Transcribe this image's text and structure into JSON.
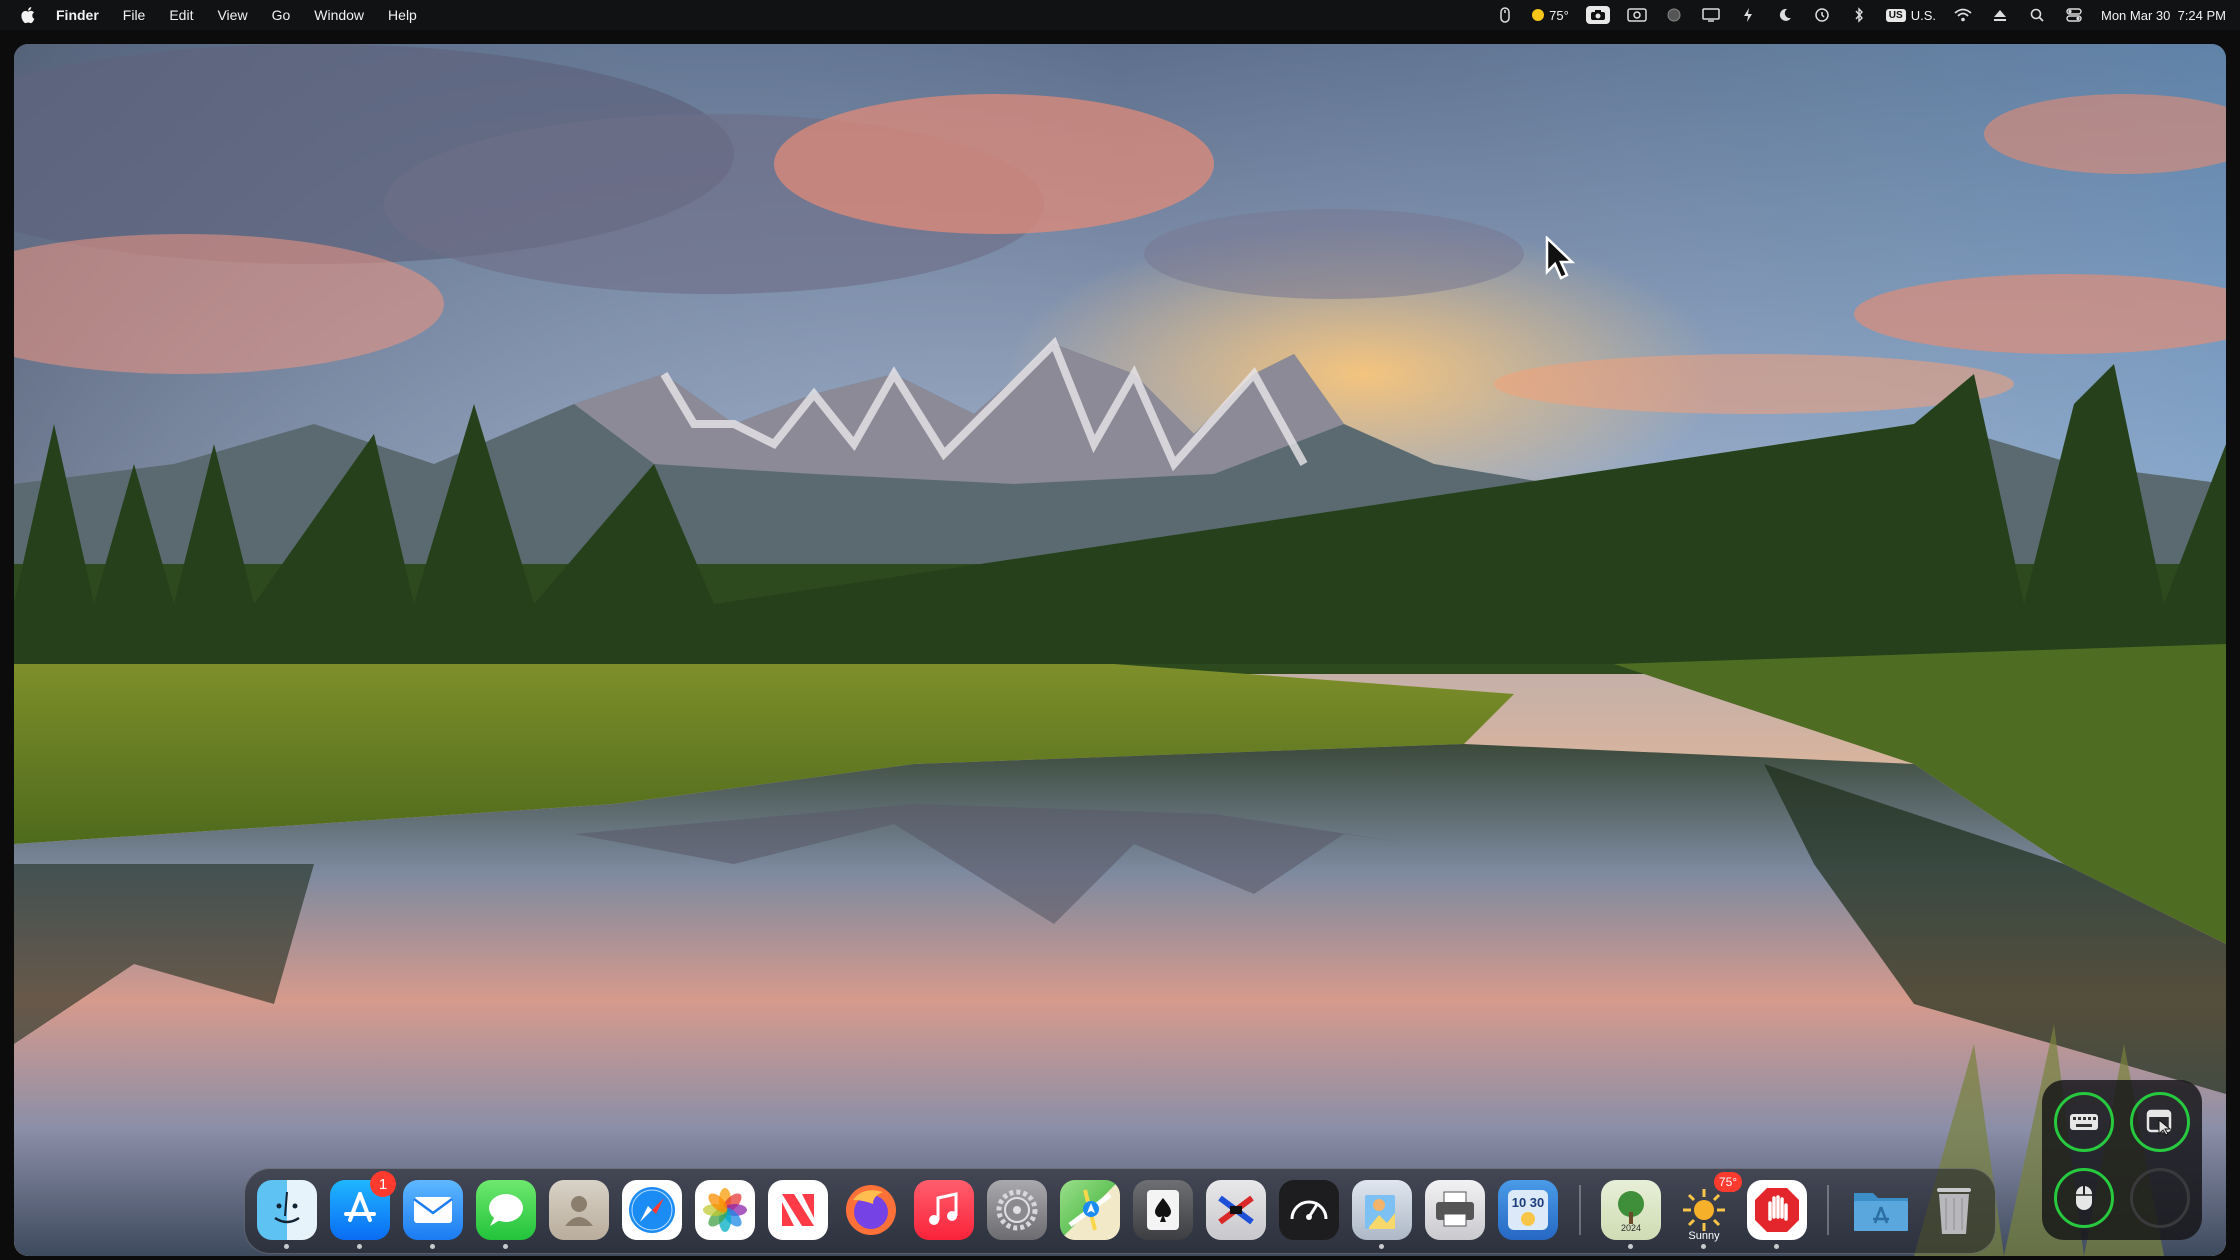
{
  "menubar": {
    "app_name": "Finder",
    "menus": [
      "File",
      "Edit",
      "View",
      "Go",
      "Window",
      "Help"
    ],
    "weather_temp": "75°",
    "input_source": "U.S.",
    "input_badge": "US",
    "clock": "Mon Mar 30  7:24 PM"
  },
  "dock": {
    "apps": [
      {
        "name": "Finder",
        "running": true
      },
      {
        "name": "App Store",
        "badge": "1",
        "running": true
      },
      {
        "name": "Mail",
        "running": true
      },
      {
        "name": "Messages",
        "running": true
      },
      {
        "name": "Contacts"
      },
      {
        "name": "Safari"
      },
      {
        "name": "Photos"
      },
      {
        "name": "News"
      },
      {
        "name": "Firefox"
      },
      {
        "name": "Music"
      },
      {
        "name": "System Settings"
      },
      {
        "name": "Maps"
      },
      {
        "name": "Solitaire"
      },
      {
        "name": "Nonogram"
      },
      {
        "name": "Activity Monitor"
      },
      {
        "name": "Preview",
        "running": true
      },
      {
        "name": "Printer"
      },
      {
        "name": "Screen Time"
      },
      {
        "name": "Calendar 2024",
        "running": true
      },
      {
        "name": "Weather",
        "running": true
      },
      {
        "name": "Stop",
        "running": true
      },
      {
        "name": "Applications Folder"
      },
      {
        "name": "Trash"
      }
    ],
    "calendar_label": "2024",
    "calendar_date": "10 30",
    "weather_widget": {
      "temp": "75°",
      "condition": "Sunny"
    }
  },
  "colors": {
    "menubar_bg": "#111214",
    "accent_green": "#27c93f",
    "badge_red": "#ff3b30"
  }
}
